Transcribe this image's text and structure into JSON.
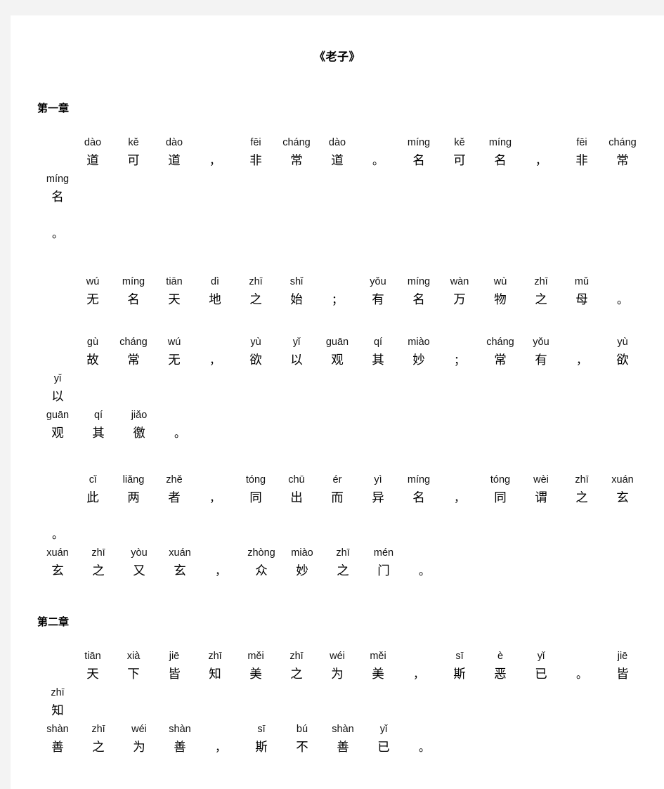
{
  "document": {
    "title": "《老子》",
    "background_color": "#f3f3f3",
    "page_color": "#ffffff",
    "text_color": "#000000"
  },
  "chapters": [
    {
      "heading": "第一章",
      "paragraphs": [
        {
          "id": "p1",
          "lines": [
            {
              "lead": true,
              "cells": [
                {
                  "py": "dào",
                  "hz": "道"
                },
                {
                  "py": "kě",
                  "hz": "可"
                },
                {
                  "py": "dào",
                  "hz": "道"
                },
                {
                  "py": "",
                  "hz": "，",
                  "punct": true
                },
                {
                  "py": "fēi",
                  "hz": "非"
                },
                {
                  "py": "cháng",
                  "hz": "常"
                },
                {
                  "py": "dào",
                  "hz": "道"
                },
                {
                  "py": "",
                  "hz": "。",
                  "punct": true
                },
                {
                  "py": "míng",
                  "hz": "名"
                },
                {
                  "py": "kě",
                  "hz": "可"
                },
                {
                  "py": "míng",
                  "hz": "名"
                },
                {
                  "py": "",
                  "hz": "，",
                  "punct": true
                },
                {
                  "py": "fēi",
                  "hz": "非"
                },
                {
                  "py": "cháng",
                  "hz": "常"
                },
                {
                  "py": "míng",
                  "hz": "名"
                }
              ]
            },
            {
              "lead": false,
              "outdent": true,
              "cells": [
                {
                  "py": "",
                  "hz": "。",
                  "punct": true
                }
              ]
            }
          ]
        },
        {
          "id": "p2",
          "lines": [
            {
              "lead": true,
              "cells": [
                {
                  "py": "wú",
                  "hz": "无"
                },
                {
                  "py": "míng",
                  "hz": "名"
                },
                {
                  "py": "tiān",
                  "hz": "天"
                },
                {
                  "py": "dì",
                  "hz": "地"
                },
                {
                  "py": "zhī",
                  "hz": "之"
                },
                {
                  "py": "shǐ",
                  "hz": "始"
                },
                {
                  "py": "",
                  "hz": "；",
                  "punct": true
                },
                {
                  "py": "yǒu",
                  "hz": "有"
                },
                {
                  "py": "míng",
                  "hz": "名"
                },
                {
                  "py": "wàn",
                  "hz": "万"
                },
                {
                  "py": "wù",
                  "hz": "物"
                },
                {
                  "py": "zhī",
                  "hz": "之"
                },
                {
                  "py": "mǔ",
                  "hz": "母"
                },
                {
                  "py": "",
                  "hz": "。",
                  "punct": true
                }
              ]
            }
          ]
        },
        {
          "id": "p3",
          "lines": [
            {
              "lead": true,
              "cells": [
                {
                  "py": "gù",
                  "hz": "故"
                },
                {
                  "py": "cháng",
                  "hz": "常"
                },
                {
                  "py": "wú",
                  "hz": "无"
                },
                {
                  "py": "",
                  "hz": "，",
                  "punct": true
                },
                {
                  "py": "yù",
                  "hz": "欲"
                },
                {
                  "py": "yǐ",
                  "hz": "以"
                },
                {
                  "py": "guān",
                  "hz": "观"
                },
                {
                  "py": "qí",
                  "hz": "其"
                },
                {
                  "py": "miào",
                  "hz": "妙"
                },
                {
                  "py": "",
                  "hz": "；",
                  "punct": true
                },
                {
                  "py": "cháng",
                  "hz": "常"
                },
                {
                  "py": "yǒu",
                  "hz": "有"
                },
                {
                  "py": "",
                  "hz": "，",
                  "punct": true
                },
                {
                  "py": "yù",
                  "hz": "欲"
                },
                {
                  "py": "yǐ",
                  "hz": "以"
                }
              ]
            },
            {
              "lead": false,
              "cells": [
                {
                  "py": "guān",
                  "hz": "观"
                },
                {
                  "py": "qí",
                  "hz": "其"
                },
                {
                  "py": "jiǎo",
                  "hz": "徼"
                },
                {
                  "py": "",
                  "hz": "。",
                  "punct": true
                }
              ]
            }
          ]
        },
        {
          "id": "p4",
          "lines": [
            {
              "lead": true,
              "cells": [
                {
                  "py": "cǐ",
                  "hz": "此"
                },
                {
                  "py": "liǎng",
                  "hz": "两"
                },
                {
                  "py": "zhě",
                  "hz": "者"
                },
                {
                  "py": "",
                  "hz": "，",
                  "punct": true
                },
                {
                  "py": "tóng",
                  "hz": "同"
                },
                {
                  "py": "chū",
                  "hz": "出"
                },
                {
                  "py": "ér",
                  "hz": "而"
                },
                {
                  "py": "yì",
                  "hz": "异"
                },
                {
                  "py": "míng",
                  "hz": "名"
                },
                {
                  "py": "",
                  "hz": "，",
                  "punct": true
                },
                {
                  "py": "tóng",
                  "hz": "同"
                },
                {
                  "py": "wèi",
                  "hz": "谓"
                },
                {
                  "py": "zhī",
                  "hz": "之"
                },
                {
                  "py": "xuán",
                  "hz": "玄"
                },
                {
                  "py": "",
                  "hz": "。",
                  "punct": true
                }
              ]
            },
            {
              "lead": false,
              "cells": [
                {
                  "py": "xuán",
                  "hz": "玄"
                },
                {
                  "py": "zhī",
                  "hz": "之"
                },
                {
                  "py": "yòu",
                  "hz": "又"
                },
                {
                  "py": "xuán",
                  "hz": "玄"
                },
                {
                  "py": "",
                  "hz": "，",
                  "punct": true
                },
                {
                  "py": "zhòng",
                  "hz": "众"
                },
                {
                  "py": "miào",
                  "hz": "妙"
                },
                {
                  "py": "zhī",
                  "hz": "之"
                },
                {
                  "py": "mén",
                  "hz": "门"
                },
                {
                  "py": "",
                  "hz": "。",
                  "punct": true
                }
              ]
            }
          ]
        }
      ]
    },
    {
      "heading": "第二章",
      "paragraphs": [
        {
          "id": "p5",
          "lines": [
            {
              "lead": true,
              "cells": [
                {
                  "py": "tiān",
                  "hz": "天"
                },
                {
                  "py": "xià",
                  "hz": "下"
                },
                {
                  "py": "jiē",
                  "hz": "皆"
                },
                {
                  "py": "zhī",
                  "hz": "知"
                },
                {
                  "py": "měi",
                  "hz": "美"
                },
                {
                  "py": "zhī",
                  "hz": "之"
                },
                {
                  "py": "wéi",
                  "hz": "为"
                },
                {
                  "py": "měi",
                  "hz": "美"
                },
                {
                  "py": "",
                  "hz": "，",
                  "punct": true
                },
                {
                  "py": "sī",
                  "hz": "斯"
                },
                {
                  "py": "è",
                  "hz": "恶"
                },
                {
                  "py": "yǐ",
                  "hz": "已"
                },
                {
                  "py": "",
                  "hz": "。",
                  "punct": true
                },
                {
                  "py": "jiē",
                  "hz": "皆"
                },
                {
                  "py": "zhī",
                  "hz": "知"
                }
              ]
            },
            {
              "lead": false,
              "cells": [
                {
                  "py": "shàn",
                  "hz": "善"
                },
                {
                  "py": "zhī",
                  "hz": "之"
                },
                {
                  "py": "wéi",
                  "hz": "为"
                },
                {
                  "py": "shàn",
                  "hz": "善"
                },
                {
                  "py": "",
                  "hz": "，",
                  "punct": true
                },
                {
                  "py": "sī",
                  "hz": "斯"
                },
                {
                  "py": "bú",
                  "hz": "不"
                },
                {
                  "py": "shàn",
                  "hz": "善"
                },
                {
                  "py": "yǐ",
                  "hz": "已"
                },
                {
                  "py": "",
                  "hz": "。",
                  "punct": true
                }
              ]
            }
          ]
        }
      ]
    }
  ]
}
